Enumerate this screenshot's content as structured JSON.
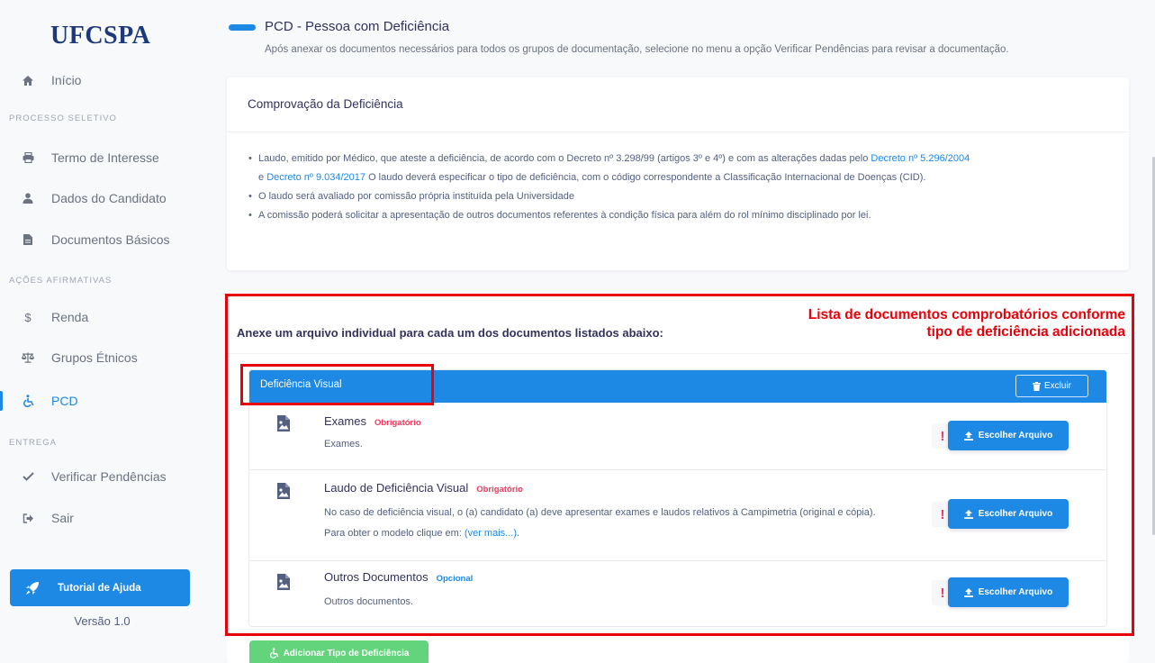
{
  "app": {
    "logo": "UFCSPA",
    "version": "Versão 1.0"
  },
  "sidebar": {
    "items": [
      {
        "label": "Início",
        "icon": "home-icon"
      },
      {
        "label": "Termo de Interesse",
        "icon": "printer-icon"
      },
      {
        "label": "Dados do Candidato",
        "icon": "user-icon"
      },
      {
        "label": "Documentos Básicos",
        "icon": "file-icon"
      },
      {
        "label": "Renda",
        "icon": "dollar-icon"
      },
      {
        "label": "Grupos Étnicos",
        "icon": "balance-icon"
      },
      {
        "label": "PCD",
        "icon": "wheelchair-icon",
        "active": true
      },
      {
        "label": "Verificar Pendências",
        "icon": "check-icon"
      },
      {
        "label": "Sair",
        "icon": "sign-out-icon"
      }
    ],
    "sections": [
      "PROCESSO SELETIVO",
      "AÇÕES AFIRMATIVAS",
      "ENTREGA"
    ],
    "help_button": "Tutorial de Ajuda"
  },
  "header": {
    "title": "PCD - Pessoa com Deficiência",
    "subtitle": "Após anexar os documentos necessários para todos os grupos de documentação, selecione no menu a opção Verificar Pendências para revisar a documentação."
  },
  "proof_card": {
    "title": "Comprovação da Deficiência",
    "b1_part1": "Laudo, emitido por Médico, que ateste a deficiência, de acordo com o Decreto nº 3.298/99 (artigos 3º e 4º) e com as alterações dadas pelo ",
    "b1_link1": "Decreto nº 5.296/2004",
    "b1_part2": " e ",
    "b1_link2": "Decreto nº 9.034/2017",
    "b1_part3": " O laudo deverá especificar o tipo de deficiência, com o código correspondente a Classificação Internacional de Doenças (CID).",
    "b2": "O laudo será avaliado por comissão própria instituída pela Universidade",
    "b3": "A comissão poderá solicitar a apresentação de outros documentos referentes à condição física para além do rol mínimo disciplinado por lei."
  },
  "upload_card": {
    "title": "Anexe um arquivo individual para cada um dos documentos listados abaixo:",
    "group_name": "Deficiência Visual",
    "delete_label": "Excluir",
    "choose_label": "Escolher Arquivo",
    "warn_symbol": "!",
    "docs": [
      {
        "name": "Exames",
        "badge": "Obrigatório",
        "desc": "Exames."
      },
      {
        "name": "Laudo de Deficiência Visual",
        "badge": "Obrigatório",
        "desc": "No caso de deficiência visual, o (a) candidato (a) deve apresentar exames e laudos relativos à Campimetria (original e cópia). Para obter o modelo clique em: ",
        "link": "(ver mais...)",
        "desc_end": "."
      },
      {
        "name": "Outros Documentos",
        "badge": "Opcional",
        "desc": "Outros documentos."
      }
    ],
    "add_button": "Adicionar Tipo de Deficiência"
  },
  "annotation": {
    "text_line1": "Lista de documentos comprobatórios conforme",
    "text_line2": "tipo de deficiência adicionada",
    "color": "#e8000b"
  },
  "colors": {
    "primary": "#1e88e5",
    "danger": "#f5365c",
    "success": "#63d47c"
  }
}
